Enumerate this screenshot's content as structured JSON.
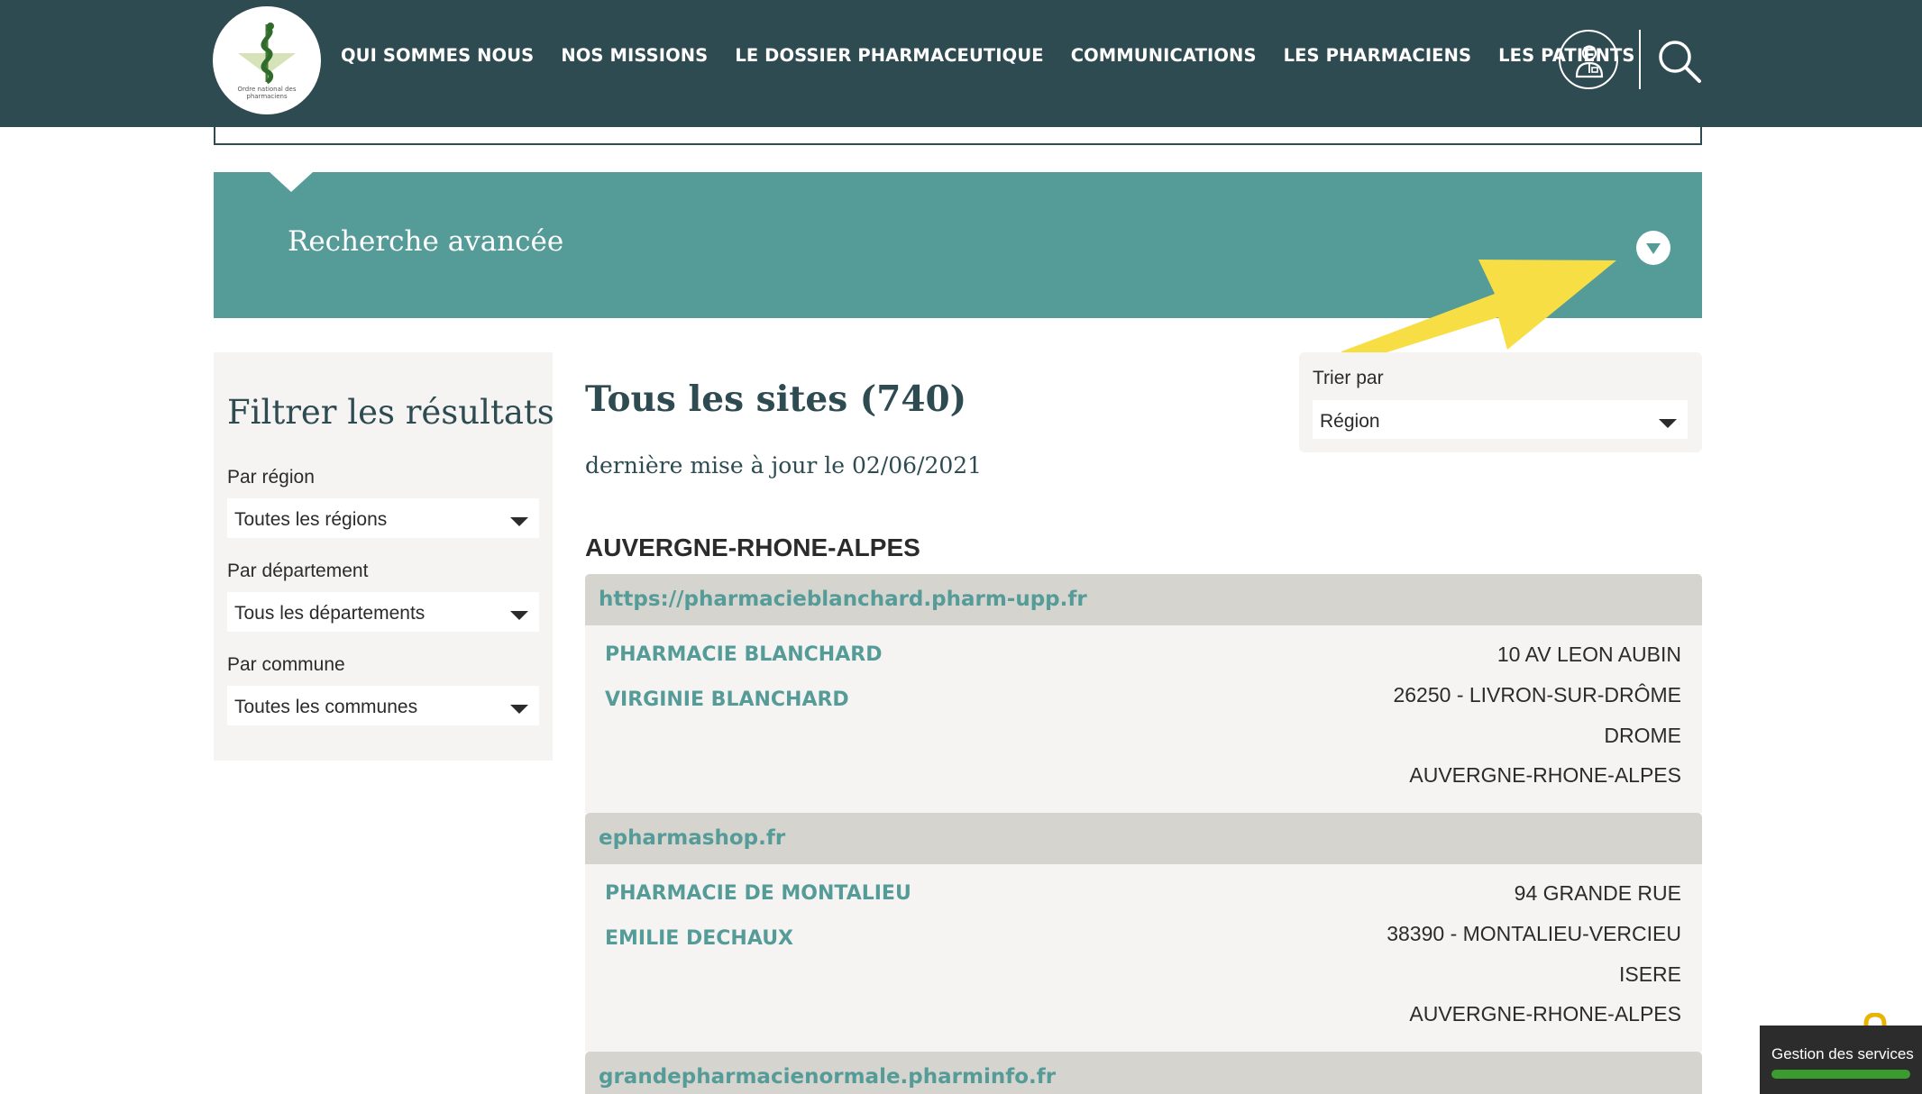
{
  "header": {
    "logo_text": "Ordre national des pharmaciens",
    "nav": [
      {
        "label": "QUI SOMMES NOUS"
      },
      {
        "label": "NOS MISSIONS"
      },
      {
        "label": "LE DOSSIER PHARMACEUTIQUE"
      },
      {
        "label": "COMMUNICATIONS"
      },
      {
        "label": "LES PHARMACIENS"
      },
      {
        "label": "LES PATIENTS"
      }
    ],
    "user_icon": "pharmacist-user-icon",
    "search_icon": "search-icon"
  },
  "advanced_search": {
    "title": "Recherche avancée",
    "toggle_icon": "chevron-down-circle-icon"
  },
  "filters": {
    "title": "Filtrer les résultats",
    "region": {
      "label": "Par région",
      "value": "Toutes les régions"
    },
    "department": {
      "label": "Par département",
      "value": "Tous les départements"
    },
    "commune": {
      "label": "Par commune",
      "value": "Toutes les communes"
    }
  },
  "main": {
    "title": "Tous les sites (740)",
    "updated": "dernière mise à jour le 02/06/2021",
    "sort": {
      "label": "Trier par",
      "value": "Région"
    },
    "region_heading": "AUVERGNE-RHONE-ALPES",
    "sites": [
      {
        "url": "https://pharmacieblanchard.pharm-upp.fr",
        "pharmacy": "PHARMACIE BLANCHARD",
        "pharmacist": "VIRGINIE BLANCHARD",
        "address": [
          "10 AV LEON AUBIN",
          "26250 - LIVRON-SUR-DRÔME",
          "DROME",
          "AUVERGNE-RHONE-ALPES"
        ]
      },
      {
        "url": "epharmashop.fr",
        "pharmacy": "PHARMACIE DE MONTALIEU",
        "pharmacist": "EMILIE DECHAUX",
        "address": [
          "94 GRANDE RUE",
          "38390 - MONTALIEU-VERCIEU",
          "ISERE",
          "AUVERGNE-RHONE-ALPES"
        ]
      },
      {
        "url": "grandepharmacienormale.pharminfo.fr"
      }
    ]
  },
  "services_widget": {
    "label": "Gestion des services",
    "accent": "#3b9b2f"
  },
  "colors": {
    "header_bg": "#2e4b52",
    "teal": "#559c98",
    "panel_bg": "#f5f4f2",
    "url_bar_bg": "#d6d4cf",
    "annotation_arrow": "#f8de45"
  }
}
